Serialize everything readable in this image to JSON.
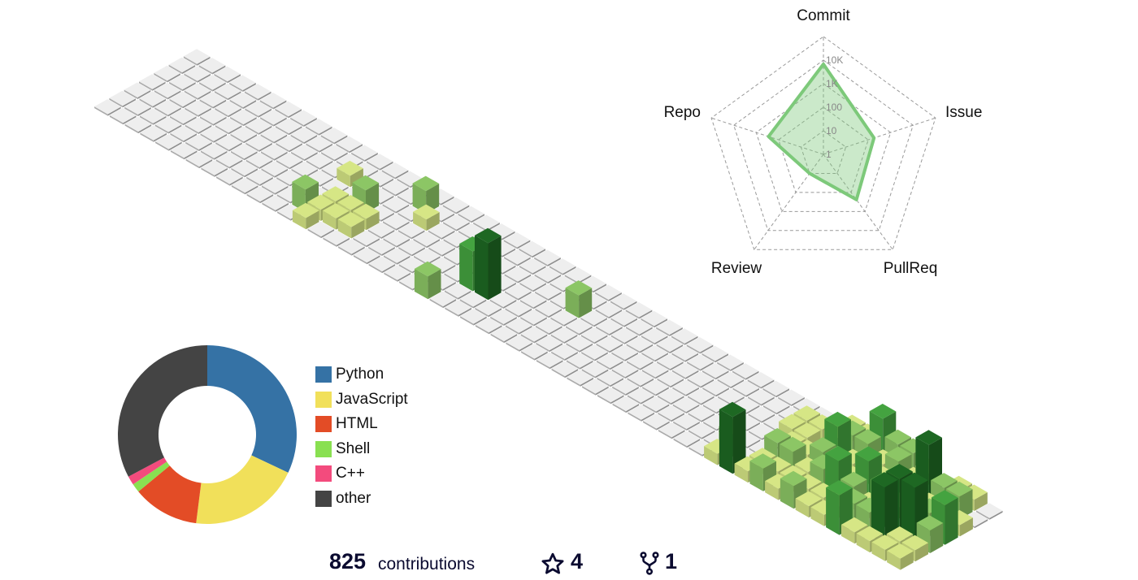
{
  "summary": {
    "contributions": "825",
    "contributions_label": "contributions",
    "stars": "4",
    "forks": "1",
    "star_icon": "star-icon",
    "fork_icon": "fork-icon"
  },
  "chart_data": [
    {
      "type": "heatmap",
      "title": "3D contribution calendar",
      "weeks": 53,
      "days": 7,
      "level_colors": [
        "#eeeeee",
        "#d6e685",
        "#8cc665",
        "#44a340",
        "#1e6823"
      ],
      "levels": [
        [
          0,
          0,
          0,
          0,
          0,
          0,
          0
        ],
        [
          0,
          0,
          0,
          0,
          0,
          0,
          0
        ],
        [
          0,
          0,
          0,
          0,
          0,
          0,
          0
        ],
        [
          0,
          0,
          0,
          0,
          0,
          0,
          0
        ],
        [
          0,
          0,
          0,
          0,
          0,
          0,
          0
        ],
        [
          0,
          0,
          0,
          0,
          0,
          0,
          0
        ],
        [
          0,
          0,
          0,
          0,
          0,
          0,
          0
        ],
        [
          0,
          0,
          0,
          0,
          0,
          0,
          0
        ],
        [
          0,
          0,
          0,
          0,
          0,
          0,
          0
        ],
        [
          0,
          0,
          0,
          0,
          0,
          0,
          0
        ],
        [
          0,
          0,
          0,
          0,
          0,
          0,
          0
        ],
        [
          0,
          0,
          0,
          0,
          0,
          0,
          0
        ],
        [
          0,
          0,
          1,
          0,
          0,
          2,
          0
        ],
        [
          0,
          0,
          0,
          0,
          1,
          1,
          1
        ],
        [
          0,
          0,
          0,
          2,
          1,
          1,
          0
        ],
        [
          0,
          0,
          0,
          0,
          1,
          1,
          0
        ],
        [
          0,
          2,
          0,
          0,
          0,
          0,
          0
        ],
        [
          0,
          0,
          1,
          0,
          0,
          0,
          0
        ],
        [
          0,
          0,
          0,
          0,
          0,
          0,
          0
        ],
        [
          0,
          0,
          0,
          0,
          0,
          0,
          0
        ],
        [
          0,
          0,
          0,
          0,
          0,
          0,
          0
        ],
        [
          0,
          0,
          0,
          0,
          0,
          0,
          2
        ],
        [
          0,
          0,
          0,
          0,
          3,
          0,
          0
        ],
        [
          0,
          0,
          0,
          0,
          4,
          0,
          0
        ],
        [
          0,
          0,
          0,
          0,
          0,
          0,
          0
        ],
        [
          0,
          0,
          0,
          0,
          0,
          0,
          0
        ],
        [
          0,
          0,
          0,
          0,
          0,
          0,
          0
        ],
        [
          0,
          0,
          2,
          0,
          0,
          0,
          0
        ],
        [
          0,
          0,
          0,
          0,
          0,
          0,
          0
        ],
        [
          0,
          0,
          0,
          0,
          0,
          0,
          0
        ],
        [
          0,
          0,
          0,
          0,
          0,
          0,
          0
        ],
        [
          0,
          0,
          0,
          0,
          0,
          0,
          0
        ],
        [
          0,
          0,
          0,
          0,
          0,
          0,
          0
        ],
        [
          0,
          0,
          0,
          0,
          0,
          0,
          0
        ],
        [
          0,
          0,
          0,
          0,
          0,
          0,
          0
        ],
        [
          0,
          0,
          0,
          0,
          0,
          0,
          0
        ],
        [
          0,
          0,
          0,
          0,
          0,
          0,
          0
        ],
        [
          0,
          0,
          0,
          0,
          0,
          0,
          0
        ],
        [
          0,
          0,
          0,
          0,
          0,
          0,
          0
        ],
        [
          0,
          0,
          0,
          0,
          0,
          0,
          0
        ],
        [
          0,
          0,
          0,
          0,
          0,
          2,
          1
        ],
        [
          0,
          1,
          1,
          0,
          0,
          0,
          4
        ],
        [
          0,
          1,
          1,
          1,
          2,
          1,
          1
        ],
        [
          1,
          1,
          0,
          1,
          2,
          1,
          2
        ],
        [
          1,
          2,
          3,
          2,
          1,
          1,
          1
        ],
        [
          3,
          2,
          1,
          2,
          2,
          1,
          2
        ],
        [
          2,
          1,
          2,
          1,
          3,
          1,
          1
        ],
        [
          2,
          2,
          1,
          3,
          2,
          1,
          1
        ],
        [
          1,
          1,
          2,
          2,
          1,
          2,
          3
        ],
        [
          0,
          4,
          2,
          1,
          3,
          2,
          1
        ],
        [
          1,
          2,
          1,
          3,
          4,
          4,
          1
        ],
        [
          1,
          2,
          1,
          2,
          4,
          1,
          1
        ],
        [
          0,
          0,
          1,
          3,
          2,
          1,
          1
        ]
      ],
      "level_heights": [
        0,
        1,
        2,
        3.5,
        5
      ]
    },
    {
      "type": "radar",
      "scale": "log",
      "axes": [
        "Commit",
        "Issue",
        "PullReq",
        "Review",
        "Repo"
      ],
      "tick_labels": [
        "1",
        "10",
        "100",
        "1K",
        "10K"
      ],
      "values": [
        670,
        18,
        24,
        1,
        28
      ],
      "fill_color": "#7dc97a",
      "fill_opacity": 0.4
    },
    {
      "type": "pie",
      "subtype": "donut",
      "categories": [
        "Python",
        "JavaScript",
        "HTML",
        "Shell",
        "C++",
        "other"
      ],
      "values": [
        32,
        20,
        12,
        1.6,
        1.6,
        32.8
      ],
      "colors": [
        "#3572A5",
        "#f1e05a",
        "#e34c26",
        "#89e051",
        "#f34b7d",
        "#444444"
      ]
    }
  ]
}
